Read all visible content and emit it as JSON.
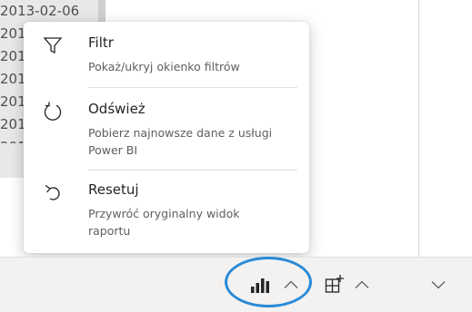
{
  "report": {
    "dates": [
      "2013-02-06",
      "201",
      "201",
      "201",
      "201",
      "201",
      "201"
    ]
  },
  "menu": {
    "items": [
      {
        "icon": "filter-icon",
        "title": "Filtr",
        "desc": "Pokaż/ukryj okienko filtrów"
      },
      {
        "icon": "refresh-icon",
        "title": "Odśwież",
        "desc": "Pobierz najnowsze dane z usługi Power BI"
      },
      {
        "icon": "reset-icon",
        "title": "Resetuj",
        "desc": "Przywróć oryginalny widok raportu"
      }
    ]
  },
  "toolbar": {
    "icons": [
      "bar-chart-icon",
      "chevron-up-icon",
      "add-visual-icon",
      "chevron-up-icon",
      "chevron-down-icon"
    ]
  },
  "colors": {
    "highlight": "#2b8ad6",
    "toolbar_bg": "#f3f2f1"
  }
}
